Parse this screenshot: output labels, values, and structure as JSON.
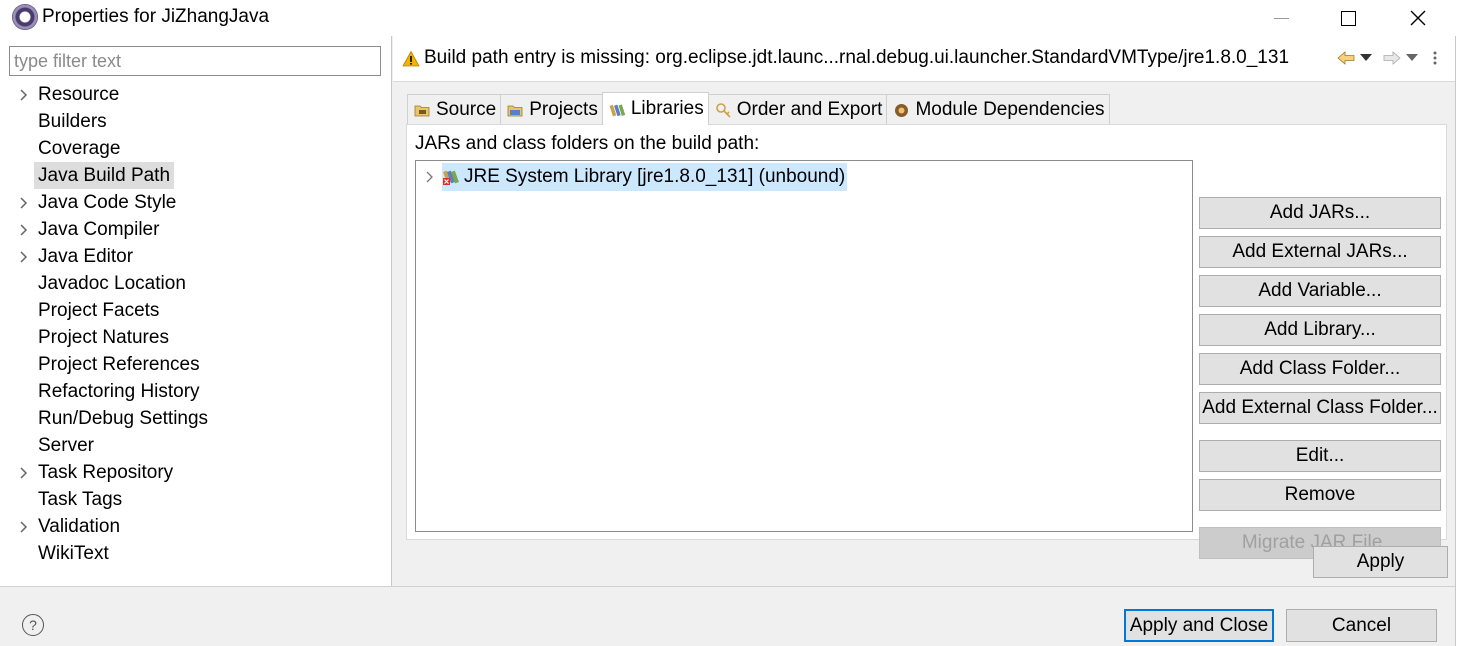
{
  "window": {
    "title": "Properties for JiZhangJava"
  },
  "filter": {
    "placeholder": "type filter text",
    "value": ""
  },
  "tree": {
    "items": [
      {
        "label": "Resource",
        "expandable": true
      },
      {
        "label": "Builders",
        "expandable": false
      },
      {
        "label": "Coverage",
        "expandable": false
      },
      {
        "label": "Java Build Path",
        "expandable": false,
        "selected": true
      },
      {
        "label": "Java Code Style",
        "expandable": true
      },
      {
        "label": "Java Compiler",
        "expandable": true
      },
      {
        "label": "Java Editor",
        "expandable": true
      },
      {
        "label": "Javadoc Location",
        "expandable": false
      },
      {
        "label": "Project Facets",
        "expandable": false
      },
      {
        "label": "Project Natures",
        "expandable": false
      },
      {
        "label": "Project References",
        "expandable": false
      },
      {
        "label": "Refactoring History",
        "expandable": false
      },
      {
        "label": "Run/Debug Settings",
        "expandable": false
      },
      {
        "label": "Server",
        "expandable": false
      },
      {
        "label": "Task Repository",
        "expandable": true
      },
      {
        "label": "Task Tags",
        "expandable": false
      },
      {
        "label": "Validation",
        "expandable": true
      },
      {
        "label": "WikiText",
        "expandable": false
      }
    ]
  },
  "banner": {
    "icon": "warning-icon",
    "message": "Build path entry is missing: org.eclipse.jdt.launc...rnal.debug.ui.launcher.StandardVMType/jre1.8.0_131"
  },
  "tabs": [
    {
      "label": "Source",
      "icon": "source-folder-icon"
    },
    {
      "label": "Projects",
      "icon": "projects-icon"
    },
    {
      "label": "Libraries",
      "icon": "libraries-icon",
      "active": true
    },
    {
      "label": "Order and Export",
      "icon": "order-export-icon"
    },
    {
      "label": "Module Dependencies",
      "icon": "module-icon"
    }
  ],
  "libraries": {
    "section_label": "JARs and class folders on the build path:",
    "entries": [
      {
        "label": "JRE System Library [jre1.8.0_131] (unbound)",
        "icon": "jre-library-error-icon",
        "selected": true
      }
    ],
    "buttons": {
      "add_jars": "Add JARs...",
      "add_external_jars": "Add External JARs...",
      "add_variable": "Add Variable...",
      "add_library": "Add Library...",
      "add_class_folder": "Add Class Folder...",
      "add_external_class_folder": "Add External Class Folder...",
      "edit": "Edit...",
      "remove": "Remove",
      "migrate_jar": "Migrate JAR File..."
    }
  },
  "actions": {
    "apply": "Apply",
    "apply_and_close": "Apply and Close",
    "cancel": "Cancel"
  },
  "colors": {
    "selection_blue": "#cce8ff",
    "primary_border": "#0078d7",
    "warning_yellow": "#f2b200"
  }
}
